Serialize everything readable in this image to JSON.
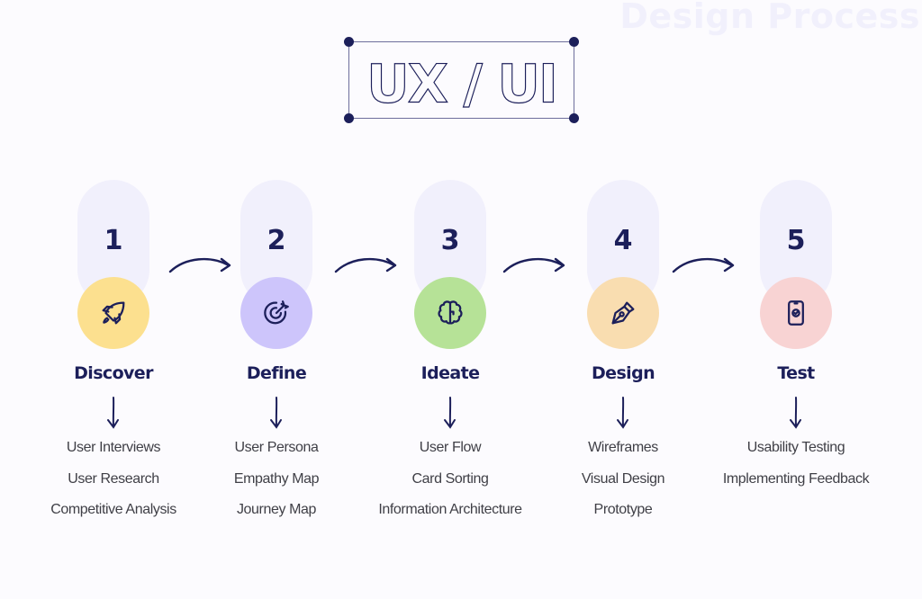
{
  "watermark": "Design Process",
  "title": {
    "text": "UX / UI"
  },
  "colors": {
    "ink": "#1c1f5a",
    "pill": "#f1f0fc",
    "text": "#3f3f46"
  },
  "steps": [
    {
      "number": "1",
      "label": "Discover",
      "icon": "rocket-icon",
      "color": "#fce08f",
      "items": [
        "User Interviews",
        "User Research",
        "Competitive Analysis"
      ]
    },
    {
      "number": "2",
      "label": "Define",
      "icon": "target-icon",
      "color": "#cdc5fb",
      "items": [
        "User Persona",
        "Empathy Map",
        "Journey Map"
      ]
    },
    {
      "number": "3",
      "label": "Ideate",
      "icon": "brain-icon",
      "color": "#b6e297",
      "items": [
        "User Flow",
        "Card Sorting",
        "Information Architecture"
      ]
    },
    {
      "number": "4",
      "label": "Design",
      "icon": "pen-nib-icon",
      "color": "#f9ddb0",
      "items": [
        "Wireframes",
        "Visual Design",
        "Prototype"
      ]
    },
    {
      "number": "5",
      "label": "Test",
      "icon": "phone-check-icon",
      "color": "#f8d3d3",
      "items": [
        "Usability Testing",
        "Implementing Feedback"
      ]
    }
  ]
}
